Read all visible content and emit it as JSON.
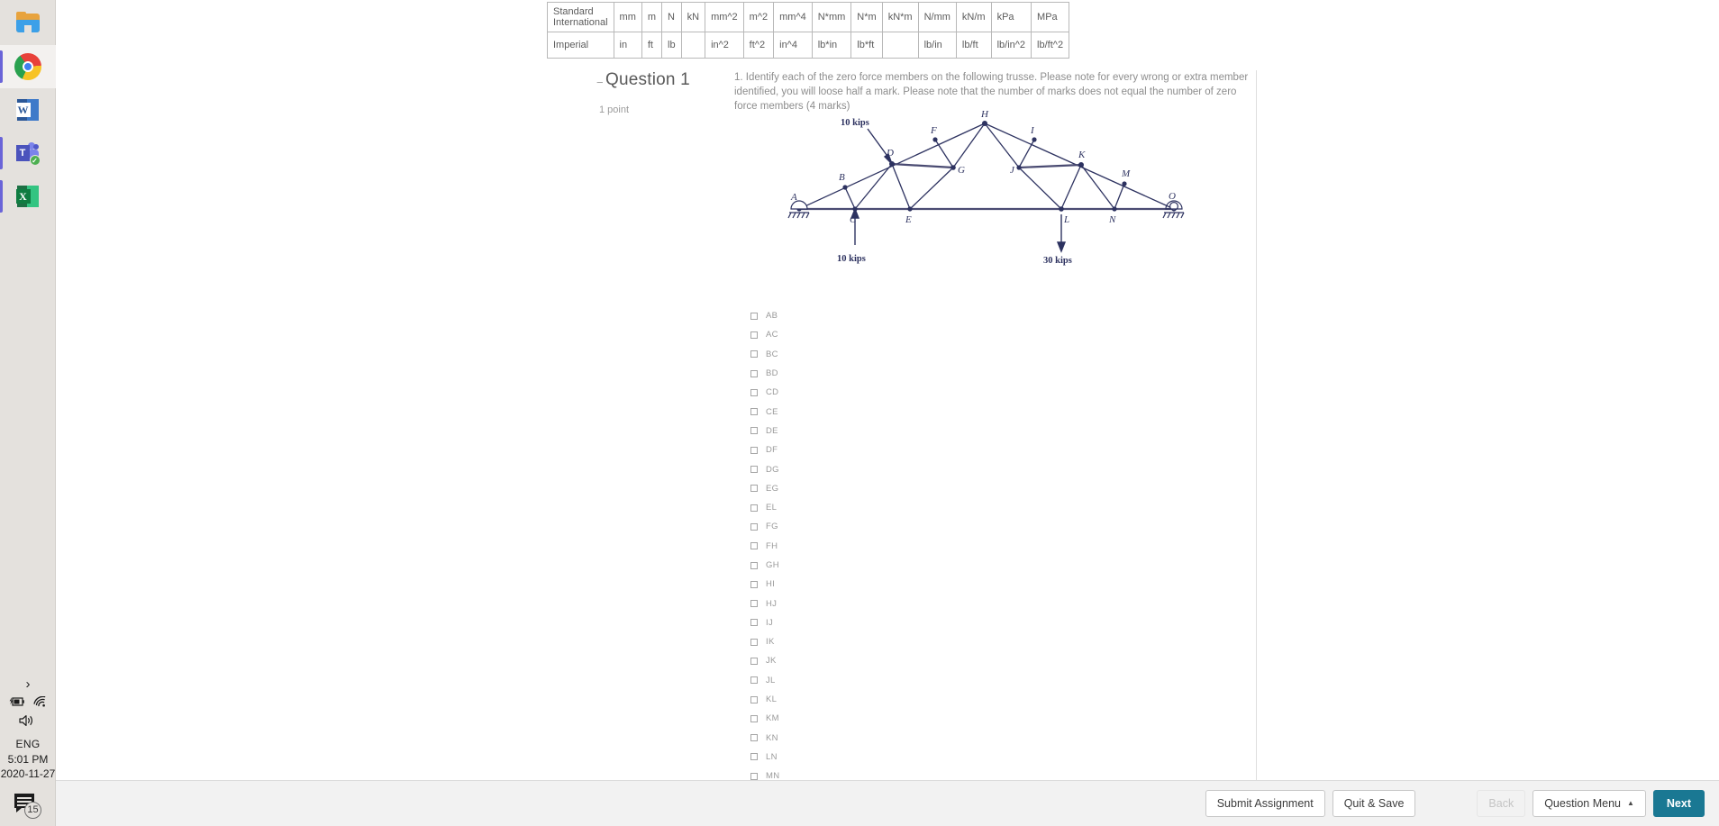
{
  "taskbar": {
    "items": [
      {
        "name": "file-explorer",
        "label": "File Explorer",
        "active": false
      },
      {
        "name": "google-chrome",
        "label": "Google Chrome",
        "active": true
      },
      {
        "name": "microsoft-word",
        "label": "Microsoft Word",
        "active": false
      },
      {
        "name": "microsoft-teams",
        "label": "Microsoft Teams",
        "active": false
      },
      {
        "name": "microsoft-excel",
        "label": "Microsoft Excel",
        "active": false
      }
    ],
    "word_glyph": "W",
    "teams_glyph": "T",
    "excel_glyph": "X",
    "teams_check_glyph": "✓",
    "tray": {
      "chevron": "›",
      "battery_icon": "battery-charging-icon",
      "battery_glyph": "🔋",
      "wifi_glyph": "◠",
      "volume_glyph": "🔊",
      "language": "ENG",
      "time": "5:01 PM",
      "date": "2020-11-27",
      "notification_count": "15"
    }
  },
  "unit_table": {
    "rows": [
      {
        "system": "Standard International",
        "cells": [
          "mm",
          "m",
          "N",
          "kN",
          "mm^2",
          "m^2",
          "mm^4",
          "N*mm",
          "N*m",
          "kN*m",
          "N/mm",
          "kN/m",
          "kPa",
          "MPa"
        ]
      },
      {
        "system": "Imperial",
        "cells": [
          "in",
          "ft",
          "lb",
          "",
          "in^2",
          "ft^2",
          "in^4",
          "lb*in",
          "lb*ft",
          "",
          "lb/in",
          "lb/ft",
          "lb/in^2",
          "lb/ft^2"
        ]
      }
    ]
  },
  "question": {
    "collapse_glyph": "−",
    "title": "Question 1",
    "points": "1 point",
    "text": "1. Identify each of the zero force members on the following trusse. Please note for every wrong or extra member identified, you will loose half a mark. Please note that the number of marks  does not equal the number of zero force members (4 marks)",
    "options": [
      "AB",
      "AC",
      "BC",
      "BD",
      "CD",
      "CE",
      "DE",
      "DF",
      "DG",
      "EG",
      "EL",
      "FG",
      "FH",
      "GH",
      "HI",
      "HJ",
      "IJ",
      "IK",
      "JK",
      "JL",
      "KL",
      "KM",
      "KN",
      "LN",
      "MN"
    ]
  },
  "truss": {
    "title": "zero-force-member-truss-diagram",
    "load_left_label": "10 kips",
    "load_bottom_left_label": "10 kips",
    "load_bottom_right_label": "30 kips",
    "joint_labels": [
      "A",
      "B",
      "C",
      "D",
      "E",
      "F",
      "G",
      "H",
      "I",
      "J",
      "K",
      "L",
      "M",
      "N",
      "O"
    ],
    "line_color": "#2d3260"
  },
  "footer": {
    "submit_label": "Submit Assignment",
    "quit_label": "Quit & Save",
    "back_label": "Back",
    "question_menu_label": "Question Menu",
    "question_menu_caret": "▲",
    "next_label": "Next",
    "primary_color": "#1a7893"
  }
}
